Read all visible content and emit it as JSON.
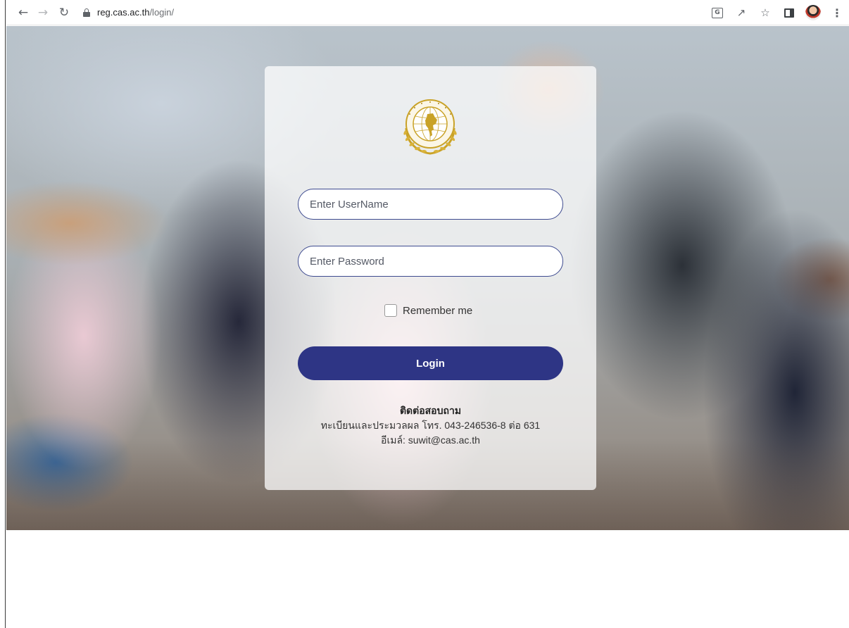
{
  "browser": {
    "url_host": "reg.cas.ac.th",
    "url_path": "/login/"
  },
  "login": {
    "logo_text": "วิทยาลัยบัณฑิตเอเซีย",
    "username_placeholder": "Enter UserName",
    "password_placeholder": "Enter Password",
    "remember_label": "Remember me",
    "remember_checked": false,
    "login_button": "Login"
  },
  "contact": {
    "title": "ติดต่อสอบถาม",
    "phone_line": "ทะเบียนและประมวลผล โทร. 043-246536-8 ต่อ 631",
    "email_line": "อีเมล์: suwit@cas.ac.th"
  },
  "colors": {
    "primary": "#2e3585",
    "logo_gold": "#c9a227"
  }
}
